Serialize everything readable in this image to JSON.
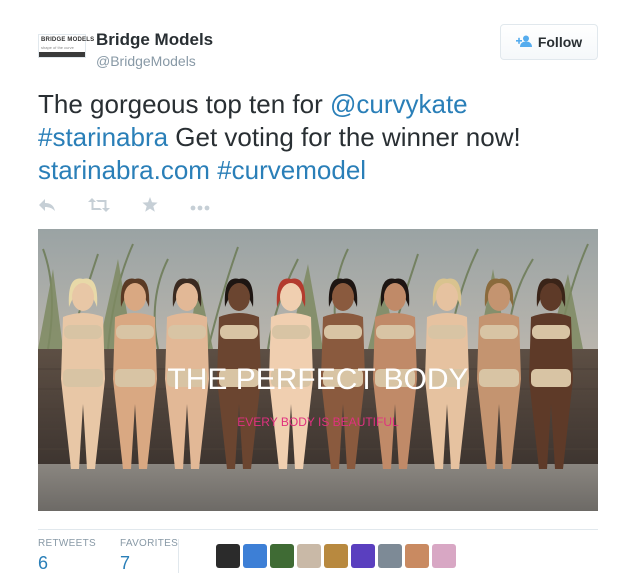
{
  "account": {
    "logo_line1": "BRIDGE MODELS",
    "logo_line2": "shape of the curve",
    "name": "Bridge Models",
    "handle": "@BridgeModels",
    "follow_label": "Follow"
  },
  "tweet": {
    "part1": "The gorgeous top ten for ",
    "mention": "@curvykate",
    "hashtag1": "#starinabra",
    "part2": " Get voting for the winner now!",
    "link": "starinabra.com",
    "hashtag2": "#curvemodel"
  },
  "actions": {
    "reply_icon": "reply-icon",
    "retweet_icon": "retweet-icon",
    "favorite_icon": "star-icon",
    "more_icon": "more-icon"
  },
  "media": {
    "headline": "THE PERFECT BODY",
    "subline": "EVERY BODY IS BEAUTIFUL"
  },
  "stats": {
    "retweets_label": "RETWEETS",
    "retweets_value": "6",
    "favorites_label": "FAVORITES",
    "favorites_value": "7"
  },
  "avatar_colors": [
    "#2b2b2b",
    "#3d7fd6",
    "#3f6b34",
    "#c9b9a7",
    "#b8893f",
    "#5a3fbf",
    "#7d8a96",
    "#c98a61",
    "#d8a7c4"
  ]
}
